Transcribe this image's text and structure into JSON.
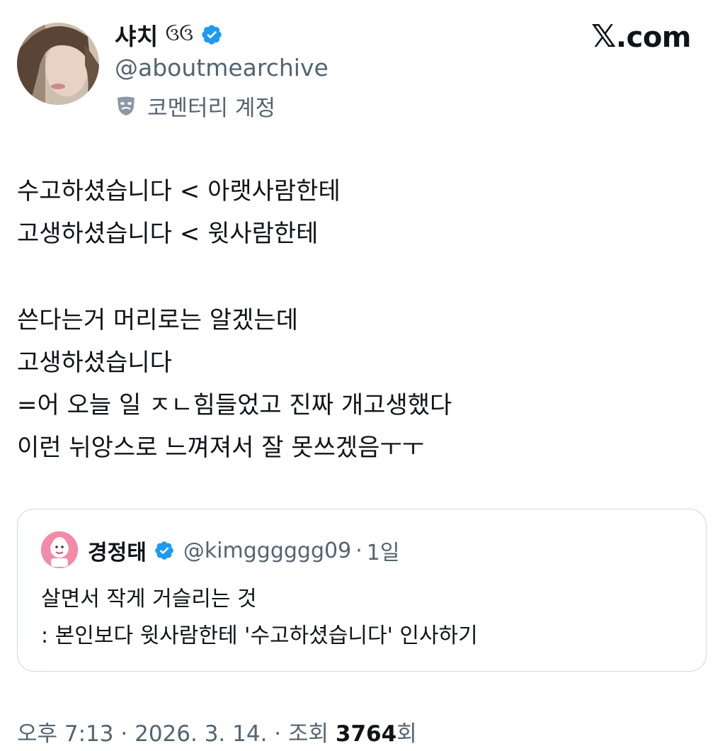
{
  "author": {
    "display_name": "샤치",
    "name_emoji": "ઉઉ",
    "handle": "@aboutmearchive",
    "commentary_label": "코멘터리 계정"
  },
  "site_brand": ".com",
  "site_brand_x": "𝕏",
  "tweet_lines": [
    "수고하셨습니다 < 아랫사람한테",
    "고생하셨습니다 < 윗사람한테",
    "쓴다는거 머리로는 알겠는데",
    "고생하셨습니다",
    "=어 오늘 일 ㅈㄴ힘들었고 진짜 개고생했다",
    "이런 뉘앙스로 느껴져서 잘 못쓰겠음ㅜㅜ"
  ],
  "quote": {
    "display_name": "경정태",
    "handle": "@kimgggggg09",
    "separator": "·",
    "age": "1일",
    "lines": [
      "살면서 작게 거슬리는 것",
      ": 본인보다 윗사람한테 '수고하셨습니다' 인사하기"
    ]
  },
  "footer": {
    "time": "오후 7:13",
    "sep1": "·",
    "date": "2026. 3. 14.",
    "sep2": "·",
    "views_label": "조회",
    "views_count": "3764",
    "views_suffix": "회"
  },
  "colors": {
    "verified": "#1d9bf0",
    "secondary_text": "#536471",
    "border": "#cfd9de"
  },
  "icons": [
    "verified-badge-icon",
    "mask-icon",
    "x-logo-icon"
  ]
}
